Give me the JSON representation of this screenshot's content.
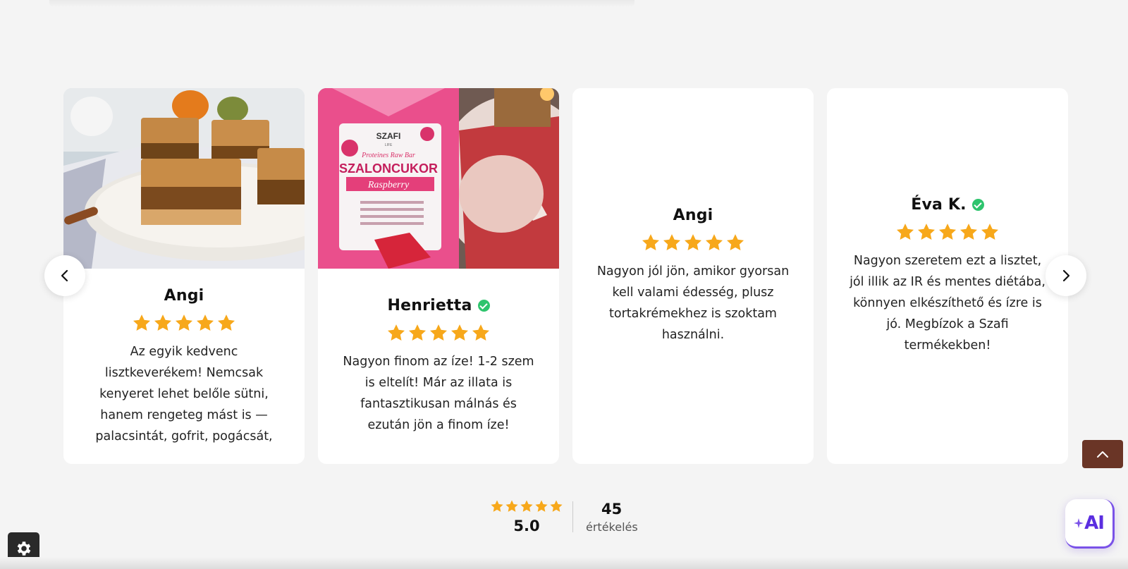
{
  "reviews": [
    {
      "name": "Angi",
      "verified": false,
      "rating": 5,
      "text": "Az egyik kedvenc lisztkeverékem! Nemcsak kenyeret lehet belőle sütni, hanem rengeteg mást is — palacsintát, gofrit, pogácsát,",
      "image": "apple-pie-slices-photo"
    },
    {
      "name": "Henrietta",
      "verified": true,
      "rating": 5,
      "text": "Nagyon finom az íze! 1-2 szem is eltelít! Már az illata is fantasztikusan málnás és ezután jön a finom íze!",
      "image": "szaloncukor-package-photo",
      "package": {
        "brand": "SZAFI",
        "brand_sub": "LIFE",
        "line": "Proteines Raw Bar",
        "product": "SZALONCUKOR",
        "flavor": "Raspberry"
      }
    },
    {
      "name": "Angi",
      "verified": false,
      "rating": 5,
      "text": "Nagyon jól jön, amikor gyorsan kell valami édesség, plusz tortakrémekhez is szoktam használni."
    },
    {
      "name": "Éva K.",
      "verified": true,
      "rating": 5,
      "text": "Nagyon szeretem ezt a lisztet, jól illik az IR és mentes diétába, könnyen elkészíthető és ízre is jó. Megbízok a Szafi termékekben!"
    }
  ],
  "summary": {
    "average": "5.0",
    "count": "45",
    "count_label": "értékelés"
  },
  "ai_button": {
    "label": "AI"
  },
  "colors": {
    "star": "#f7a81b",
    "verified": "#2ec46d",
    "scroll_top_bg": "#6a3526",
    "ai_accent": "#5b2ee0"
  },
  "icons": {
    "prev": "chevron-left-icon",
    "next": "chevron-right-icon",
    "scroll_top": "chevron-up-icon",
    "settings": "gear-icon"
  }
}
